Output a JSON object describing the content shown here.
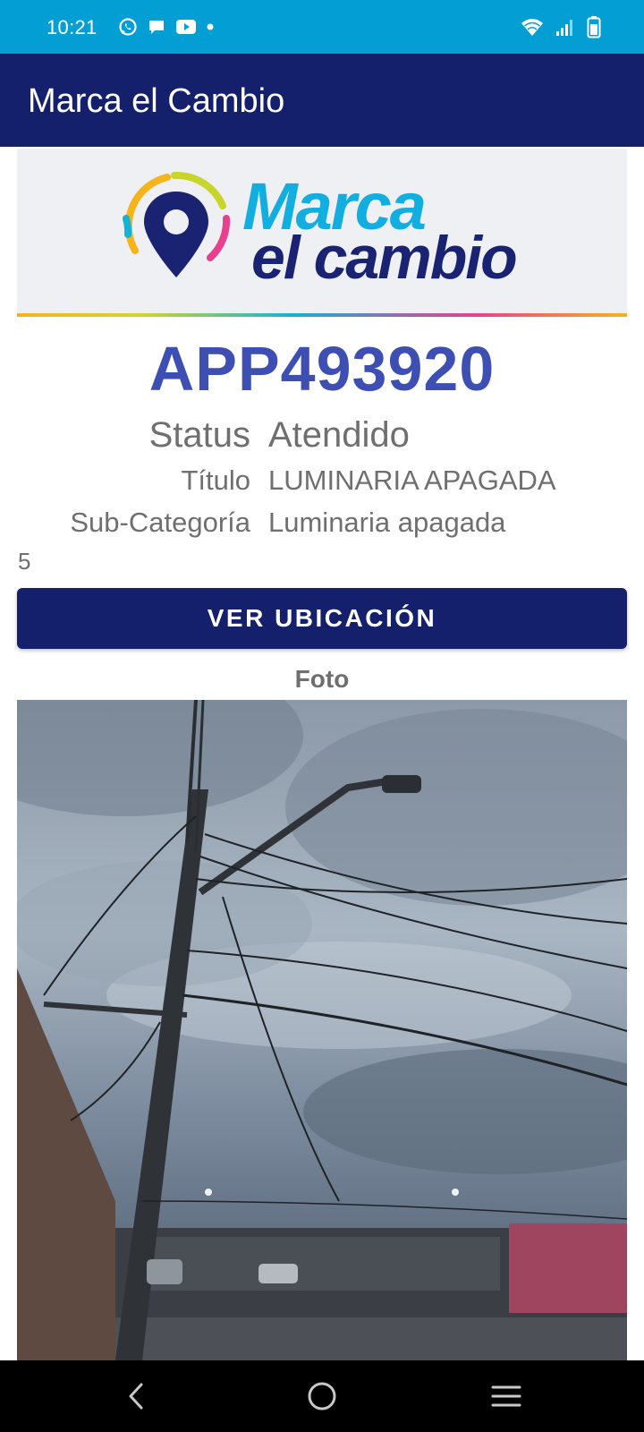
{
  "status_bar": {
    "time": "10:21",
    "notification_icons": [
      "whatsapp-icon",
      "chat-icon",
      "youtube-icon",
      "dot-icon"
    ],
    "system_icons": [
      "wifi-icon",
      "signal-icon",
      "battery-icon"
    ]
  },
  "app_bar": {
    "title": "Marca el Cambio"
  },
  "banner": {
    "brand_line1": "Marca",
    "brand_line2": "el cambio"
  },
  "report": {
    "id": "APP493920",
    "status_label": "Status",
    "status_value": "Atendido",
    "title_label": "Título",
    "title_value": "LUMINARIA APAGADA",
    "subcategory_label": "Sub-Categoría",
    "subcategory_value": "Luminaria apagada",
    "extra_number": "5"
  },
  "actions": {
    "location_button": "VER UBICACIÓN"
  },
  "photo": {
    "label": "Foto"
  },
  "nav": {
    "icons": [
      "back-icon",
      "home-icon",
      "recents-icon"
    ]
  },
  "colors": {
    "status_bar": "#039fd4",
    "primary": "#14206b",
    "report_id": "#3d4fb3",
    "text_gray": "#6f6f6f"
  }
}
